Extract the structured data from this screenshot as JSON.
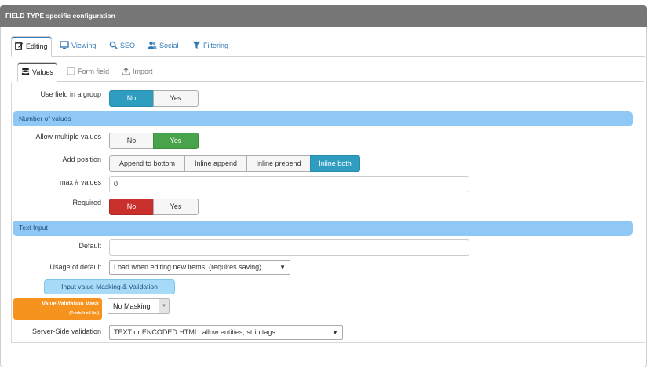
{
  "panel": {
    "title": "FIELD TYPE specific configuration"
  },
  "tabs_outer": [
    {
      "label": "Editing",
      "icon": "edit-icon",
      "active": true
    },
    {
      "label": "Viewing",
      "icon": "monitor-icon"
    },
    {
      "label": "SEO",
      "icon": "search-icon"
    },
    {
      "label": "Social",
      "icon": "users-icon"
    },
    {
      "label": "Filtering",
      "icon": "filter-icon"
    }
  ],
  "tabs_inner": [
    {
      "label": "Values",
      "icon": "database-icon",
      "active": true
    },
    {
      "label": "Form field",
      "icon": "checkbox-icon"
    },
    {
      "label": "Import",
      "icon": "upload-icon"
    }
  ],
  "group": {
    "label": "Use field in a group",
    "options": [
      "No",
      "Yes"
    ],
    "selected": "No"
  },
  "number_section": {
    "title": "Number of values"
  },
  "multiple": {
    "label": "Allow multiple values",
    "options": [
      "No",
      "Yes"
    ],
    "selected": "Yes"
  },
  "add_position": {
    "label": "Add position",
    "options": [
      "Append to bottom",
      "Inline append",
      "Inline prepend",
      "Inline both"
    ],
    "selected": "Inline both"
  },
  "max_values": {
    "label": "max # values",
    "value": "0"
  },
  "required": {
    "label": "Required",
    "options": [
      "No",
      "Yes"
    ],
    "selected": "No"
  },
  "text_section": {
    "title": "Text Input"
  },
  "default": {
    "label": "Default",
    "value": ""
  },
  "usage": {
    "label": "Usage of default",
    "value": "Load when editing new items, (requires saving)"
  },
  "masking_header": "Input value Masking & Validation",
  "validation_mask": {
    "label_line1": "Value Validation Mask",
    "label_line2": "(Predefined list)",
    "value": "No Masking"
  },
  "server_validation": {
    "label": "Server-Side validation",
    "value": "TEXT or ENCODED HTML: allow entities, strip tags"
  },
  "colors": {
    "header_bg": "#777777",
    "section_bg": "#8fc8f5",
    "active_blue": "#2e9dc0",
    "active_green": "#49a34a",
    "active_red": "#c9302c",
    "orange": "#f6931e",
    "link": "#337ab7"
  }
}
